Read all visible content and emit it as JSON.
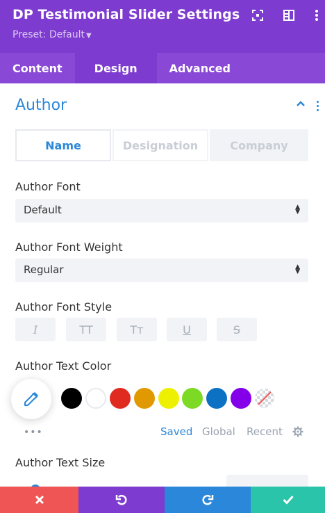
{
  "header": {
    "title": "DP Testimonial Slider Settings",
    "preset_label": "Preset: Default",
    "icons": [
      "expand-icon",
      "split-layout-icon",
      "more-icon"
    ]
  },
  "tabs": [
    {
      "label": "Content",
      "active": false
    },
    {
      "label": "Design",
      "active": true
    },
    {
      "label": "Advanced",
      "active": false
    }
  ],
  "section": {
    "title": "Author",
    "subtabs": [
      {
        "label": "Name",
        "active": true
      },
      {
        "label": "Designation",
        "active": false
      },
      {
        "label": "Company",
        "active": false
      }
    ]
  },
  "fields": {
    "font_label": "Author Font",
    "font_value": "Default",
    "weight_label": "Author Font Weight",
    "weight_value": "Regular",
    "style_label": "Author Font Style",
    "style_buttons": [
      {
        "name": "italic",
        "glyph": "I"
      },
      {
        "name": "uppercase",
        "glyph": "TT"
      },
      {
        "name": "capitalize",
        "glyph": "Tт"
      },
      {
        "name": "underline",
        "glyph": "U"
      },
      {
        "name": "strikethrough",
        "glyph": "S"
      }
    ],
    "color_label": "Author Text Color",
    "swatches": [
      "#000000",
      "#ffffff",
      "#e02b20",
      "#e09900",
      "#edf000",
      "#7cda24",
      "#0c71c3",
      "#8300e9"
    ],
    "color_tabs": [
      {
        "label": "Saved",
        "active": true
      },
      {
        "label": "Global",
        "active": false
      },
      {
        "label": "Recent",
        "active": false
      }
    ],
    "size_label": "Author Text Size"
  },
  "colors": {
    "header": "#7e3bd0",
    "tabbar": "#8a48d6",
    "accent": "#2b87da",
    "cancel": "#ef5555",
    "undo": "#7e3bd0",
    "redo": "#2b87da",
    "save": "#29c4a9"
  },
  "footer": {
    "buttons": [
      "close-icon",
      "undo-icon",
      "redo-icon",
      "check-icon"
    ]
  }
}
